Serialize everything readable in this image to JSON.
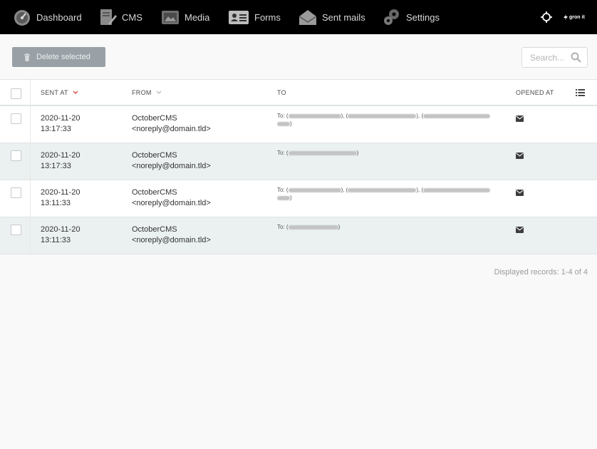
{
  "nav": {
    "items": [
      {
        "label": "Dashboard",
        "icon": "dashboard-icon"
      },
      {
        "label": "CMS",
        "icon": "cms-icon"
      },
      {
        "label": "Media",
        "icon": "media-icon"
      },
      {
        "label": "Forms",
        "icon": "forms-icon"
      },
      {
        "label": "Sent mails",
        "icon": "envelope-icon"
      },
      {
        "label": "Settings",
        "icon": "gears-icon"
      }
    ],
    "brand": "gron it"
  },
  "toolbar": {
    "delete_label": "Delete selected",
    "search_placeholder": "Search..."
  },
  "table": {
    "columns": {
      "sent_at": "SENT AT",
      "from": "FROM",
      "to": "TO",
      "opened_at": "OPENED AT"
    },
    "rows": [
      {
        "date": "2020-11-20",
        "time": "13:17:33",
        "from_name": "OctoberCMS",
        "from_email": "<noreply@domain.tld>",
        "to_prefix": "To: ("
      },
      {
        "date": "2020-11-20",
        "time": "13:17:33",
        "from_name": "OctoberCMS",
        "from_email": "<noreply@domain.tld>",
        "to_prefix": "To: ("
      },
      {
        "date": "2020-11-20",
        "time": "13:11:33",
        "from_name": "OctoberCMS",
        "from_email": "<noreply@domain.tld>",
        "to_prefix": "To: ("
      },
      {
        "date": "2020-11-20",
        "time": "13:11:33",
        "from_name": "OctoberCMS",
        "from_email": "<noreply@domain.tld>",
        "to_prefix": "To: ("
      }
    ]
  },
  "footer": {
    "records": "Displayed records: 1-4 of 4"
  },
  "colors": {
    "nav_bg": "#000000",
    "sort_arrow": "#d9534f",
    "delete_btn": "#9aa1a6",
    "alt_row": "#ebf0f1"
  }
}
